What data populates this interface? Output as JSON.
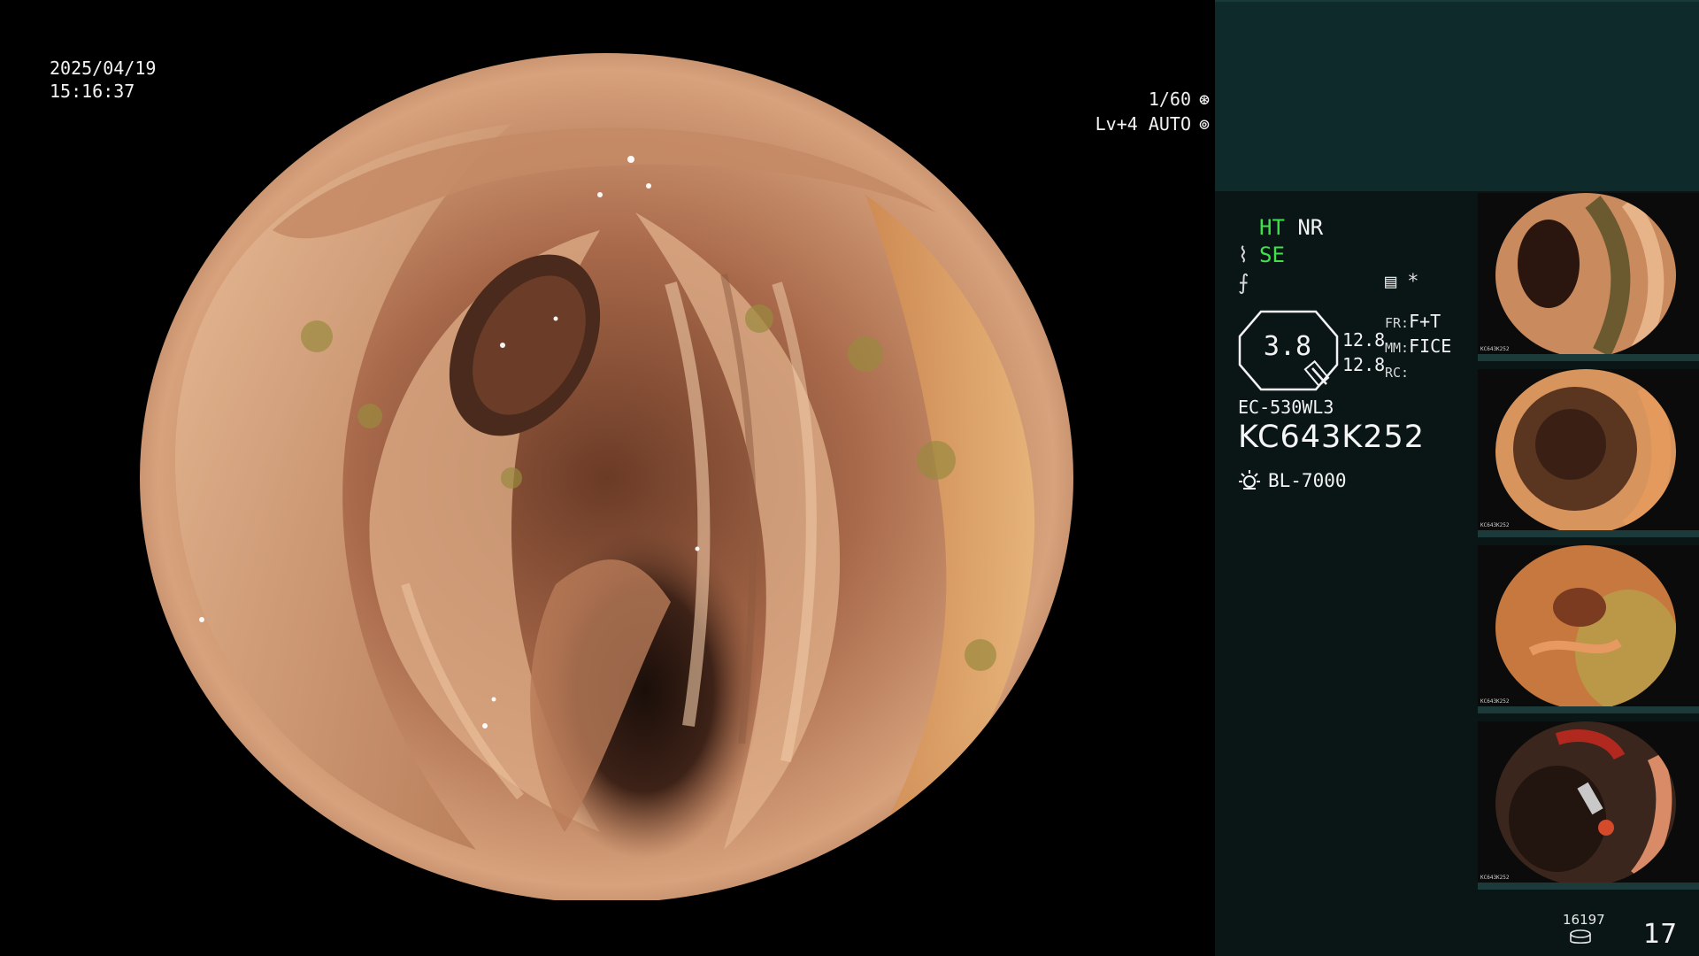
{
  "overlay": {
    "date": "2025/04/19",
    "time": "15:16:37",
    "shutter_speed": "1/60",
    "shutter_icon": "aperture-icon",
    "iris_mode": "Lv+4 AUTO",
    "iris_icon": "iris-icon"
  },
  "status": {
    "ht_label": "HT",
    "nr_label": "NR",
    "se_label": "SE",
    "se_icon": "sharpness-icon",
    "freeze_icon": "freeze-icon",
    "capture_icon": "capture-settings-icon",
    "star": "*"
  },
  "zoom": {
    "value": "3.8",
    "line1": "12.8",
    "line2": "12.8"
  },
  "settings": {
    "fr_key": "FR:",
    "fr_value": "F+T",
    "mm_key": "MM:",
    "mm_value": "FICE",
    "rc_key": "RC:",
    "rc_value": ""
  },
  "scope": {
    "model": "EC-530WL3",
    "serial": "KC643K252"
  },
  "light_source": {
    "icon": "lamp-icon",
    "label": "BL-7000"
  },
  "captures": {
    "stored_count": "16197",
    "image_count": "17",
    "thumbnails": [
      {
        "serial": "KC643K252"
      },
      {
        "serial": "KC643K252"
      },
      {
        "serial": "KC643K252"
      },
      {
        "serial": "KC643K252"
      }
    ]
  },
  "colors": {
    "panel_bg": "#0a1616",
    "panel_top": "#0e2a2a",
    "accent_green": "#3fe24a",
    "tissue_light": "#d9a57f",
    "tissue_dark": "#5a3322"
  }
}
